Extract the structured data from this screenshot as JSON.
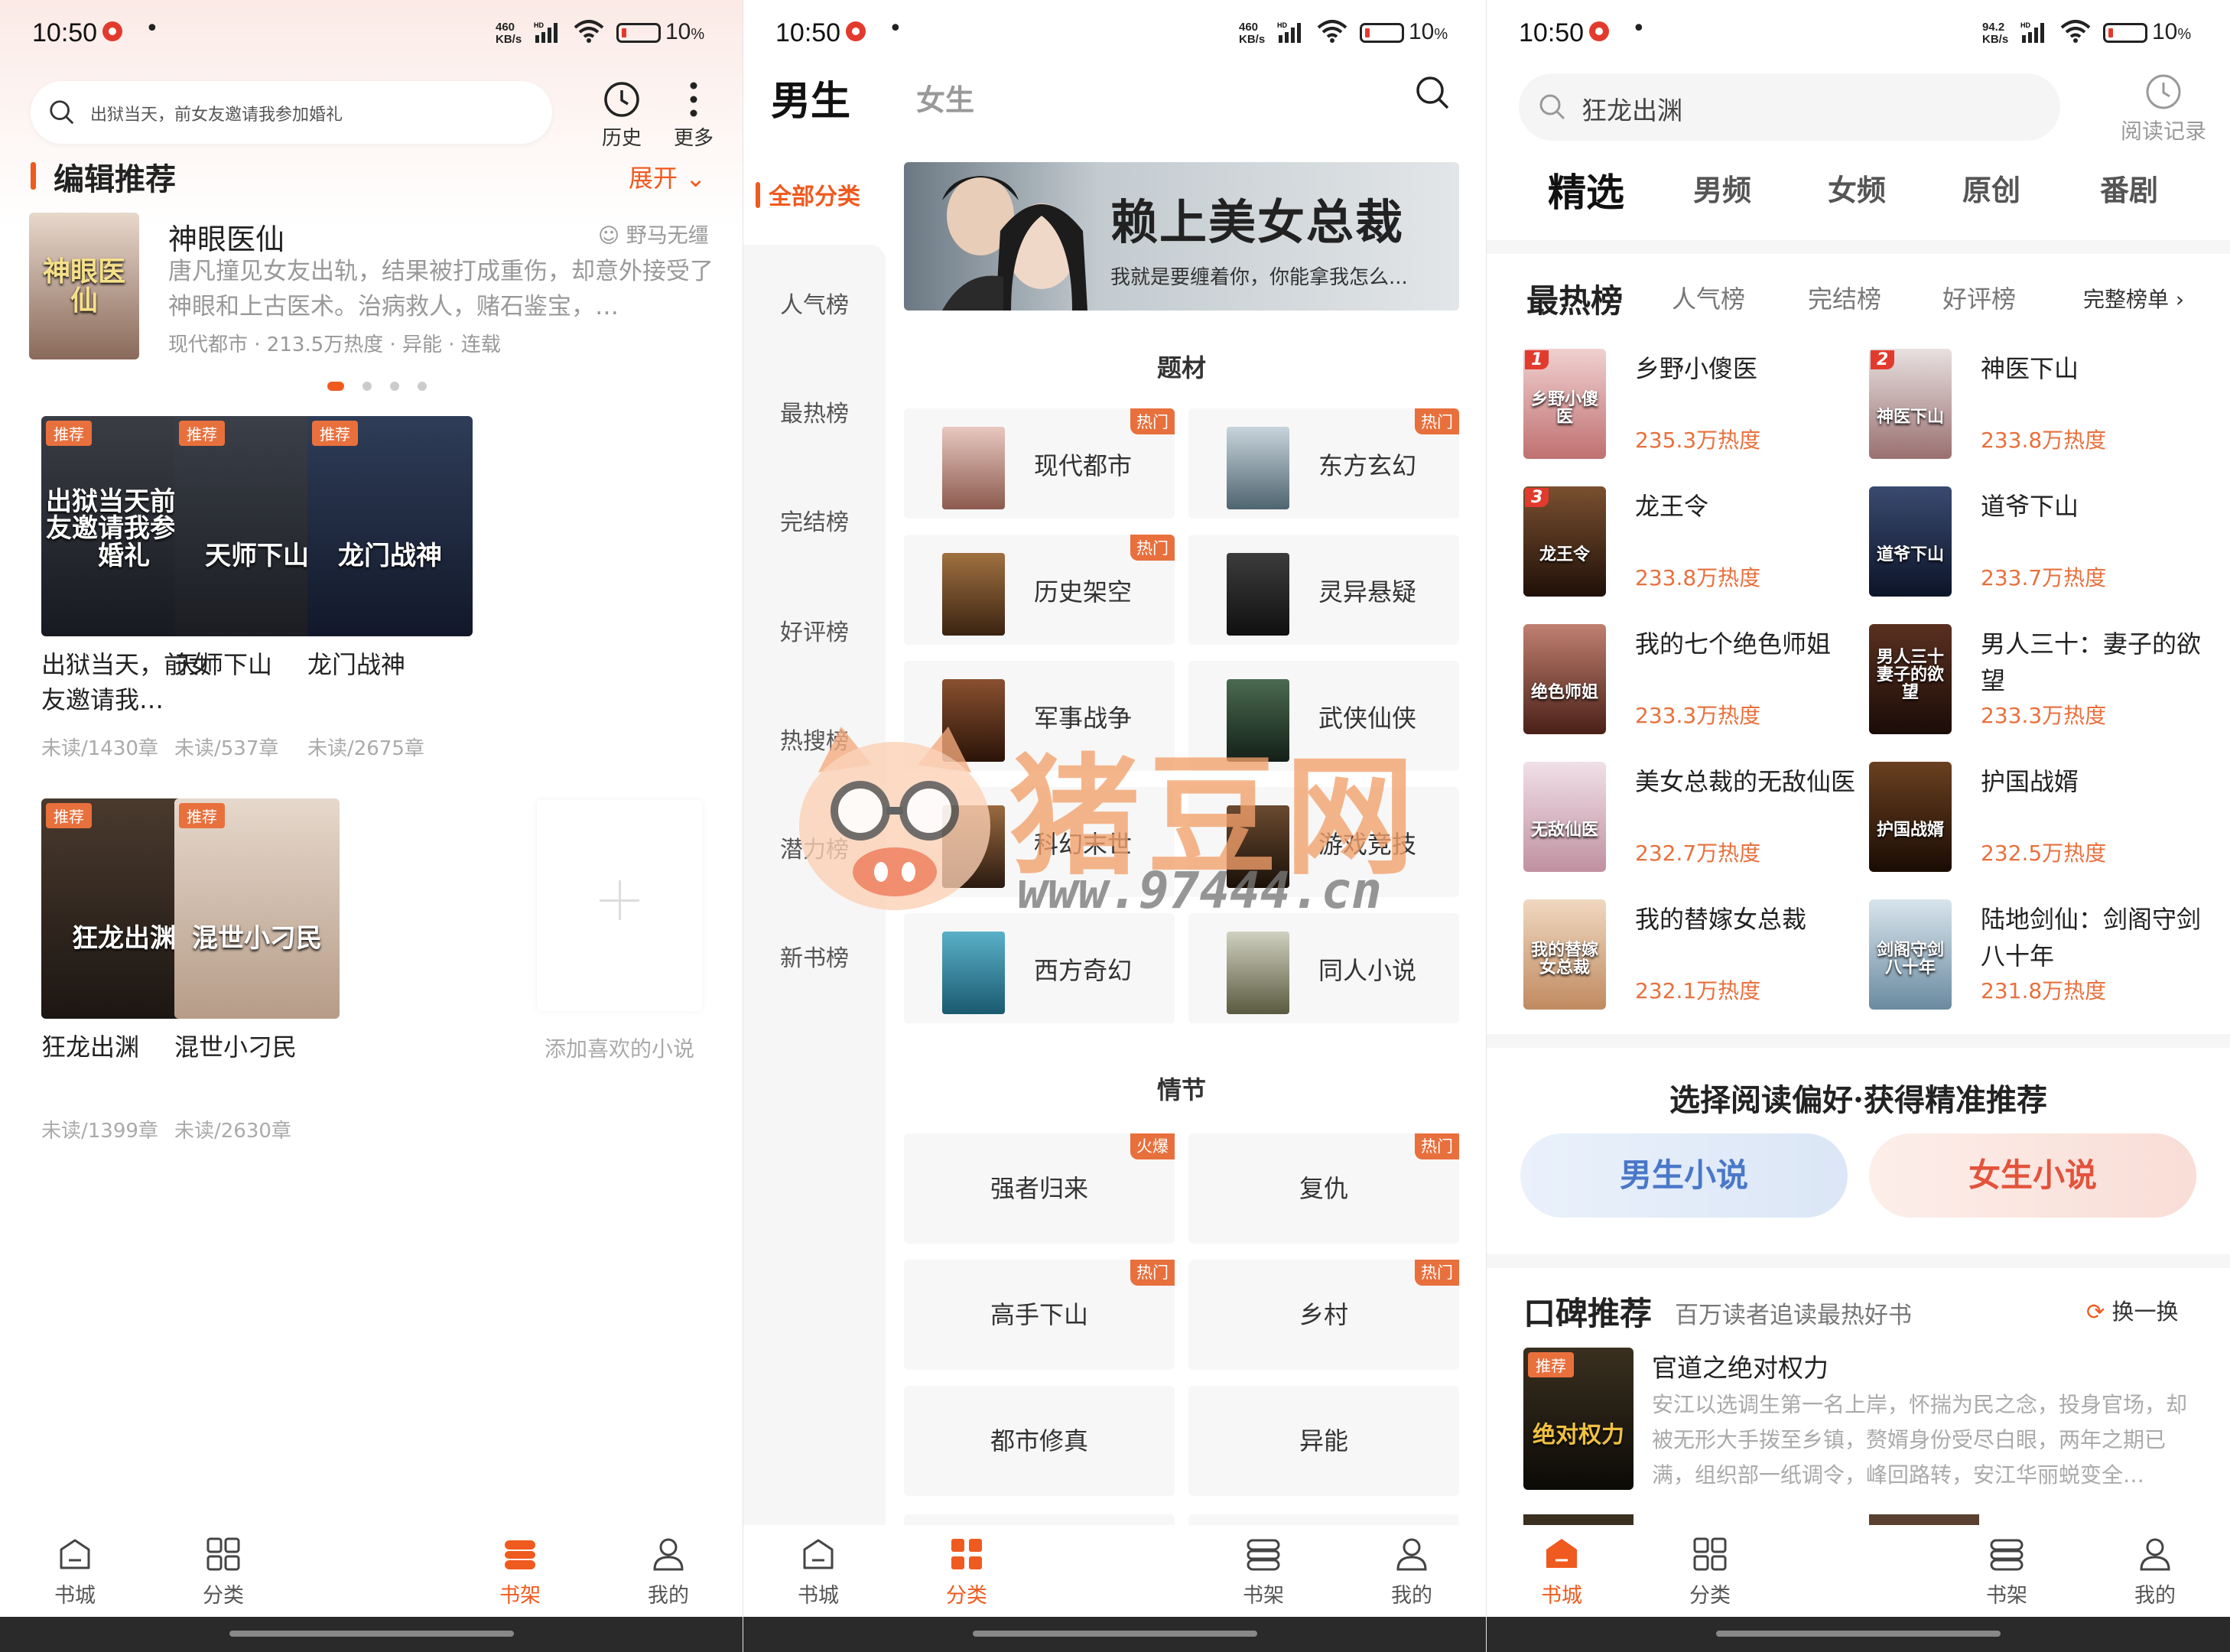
{
  "colors": {
    "accent": "#ef5a1f",
    "hot_badge": "#e8703d",
    "blue_pref": "#4a78c8",
    "red_pref": "#e3533b"
  },
  "status_bars": [
    {
      "time": "10:50",
      "speed": [
        "460",
        "KB/s"
      ],
      "hd": "HD",
      "battery": "10"
    },
    {
      "time": "10:50",
      "speed": [
        "460",
        "KB/s"
      ],
      "hd": "HD",
      "battery": "10"
    },
    {
      "time": "10:50",
      "speed": [
        "94.2",
        "KB/s"
      ],
      "hd": "HD",
      "battery": "10"
    }
  ],
  "bookshelf": {
    "search_placeholder": "出狱当天，前女友邀请我参加婚礼",
    "history_label": "历史",
    "more_label": "更多",
    "section_title": "编辑推荐",
    "expand_label": "展开",
    "featured": {
      "cover_title": "神眼医仙",
      "title": "神眼医仙",
      "author": "野马无缰",
      "desc": "唐凡撞见女友出轨，结果被打成重伤，却意外接受了神眼和上古医术。治病救人，赌石鉴宝，…",
      "meta": "现代都市 · 213.5万热度 · 异能 · 连载"
    },
    "badge": "推荐",
    "books": [
      {
        "title": "出狱当天，前女友邀请我…",
        "cover_title": "出狱当天前女友邀请我参加婚礼",
        "status": "未读/1430章",
        "c1": "#3a3d44",
        "c2": "#171a20"
      },
      {
        "title": "天师下山",
        "cover_title": "天师下山",
        "status": "未读/537章",
        "c1": "#3b3f48",
        "c2": "#1b1d22"
      },
      {
        "title": "龙门战神",
        "cover_title": "龙门战神",
        "status": "未读/2675章",
        "c1": "#2f3d58",
        "c2": "#12182a"
      },
      {
        "title": "狂龙出渊",
        "cover_title": "狂龙出渊",
        "status": "未读/1399章",
        "c1": "#4a3a2e",
        "c2": "#1c1612"
      },
      {
        "title": "混世小刁民",
        "cover_title": "混世小刁民",
        "status": "未读/2630章",
        "c1": "#e6d8cc",
        "c2": "#b69c88"
      }
    ],
    "add_label": "添加喜欢的小说"
  },
  "category": {
    "tab_male": "男生",
    "tab_female": "女生",
    "sidebar": [
      "全部分类",
      "人气榜",
      "最热榜",
      "完结榜",
      "好评榜",
      "热搜榜",
      "潜力榜",
      "新书榜"
    ],
    "banner": {
      "title": "赖上美女总裁",
      "sub": "我就是要缠着你，你能拿我怎么..."
    },
    "genre_heading": "题材",
    "genres": [
      {
        "label": "现代都市",
        "hot": "热门",
        "c1": "#e8c8c0",
        "c2": "#8c5a4e"
      },
      {
        "label": "东方玄幻",
        "hot": "热门",
        "c1": "#c8d4dc",
        "c2": "#4e6470"
      },
      {
        "label": "历史架空",
        "hot": "热门",
        "c1": "#a07040",
        "c2": "#3a2412"
      },
      {
        "label": "灵异悬疑",
        "hot": "",
        "c1": "#3c3c3c",
        "c2": "#101010"
      },
      {
        "label": "军事战争",
        "hot": "",
        "c1": "#8a5030",
        "c2": "#2a1408"
      },
      {
        "label": "武侠仙侠",
        "hot": "",
        "c1": "#4a6a50",
        "c2": "#142018"
      },
      {
        "label": "科幻末世",
        "hot": "",
        "c1": "#9a6a40",
        "c2": "#2a1a10"
      },
      {
        "label": "游戏竞技",
        "hot": "",
        "c1": "#6a4a30",
        "c2": "#1a1008"
      },
      {
        "label": "西方奇幻",
        "hot": "",
        "c1": "#5ab0c8",
        "c2": "#1a5a70"
      },
      {
        "label": "同人小说",
        "hot": "",
        "c1": "#d0d0c0",
        "c2": "#5a5a40"
      }
    ],
    "plot_heading": "情节",
    "plots": [
      {
        "label": "强者归来",
        "hot": "火爆"
      },
      {
        "label": "复仇",
        "hot": "热门"
      },
      {
        "label": "高手下山",
        "hot": "热门"
      },
      {
        "label": "乡村",
        "hot": "热门"
      },
      {
        "label": "都市修真",
        "hot": ""
      },
      {
        "label": "异能",
        "hot": ""
      }
    ]
  },
  "store": {
    "search_text": "狂龙出渊",
    "history_label": "阅读记录",
    "nav_tabs": [
      "精选",
      "男频",
      "女频",
      "原创",
      "番剧"
    ],
    "rank_tabs": [
      "最热榜",
      "人气榜",
      "完结榜",
      "好评榜"
    ],
    "full_rank": "完整榜单 ›",
    "rankings": [
      {
        "num": "1",
        "title": "乡野小傻医",
        "heat": "235.3万热度",
        "cover_title": "乡野小傻医",
        "c1": "#f0d0d0",
        "c2": "#c07070"
      },
      {
        "num": "2",
        "title": "神医下山",
        "heat": "233.8万热度",
        "cover_title": "神医下山",
        "c1": "#e8e0e0",
        "c2": "#9a7070"
      },
      {
        "num": "3",
        "title": "龙王令",
        "heat": "233.8万热度",
        "cover_title": "龙王令",
        "c1": "#7a5030",
        "c2": "#201008"
      },
      {
        "num": "",
        "title": "道爷下山",
        "heat": "233.7万热度",
        "cover_title": "道爷下山",
        "c1": "#3a4a70",
        "c2": "#0c1428"
      },
      {
        "num": "",
        "title": "我的七个绝色师姐",
        "heat": "233.3万热度",
        "cover_title": "绝色师姐",
        "c1": "#c08070",
        "c2": "#4a2018"
      },
      {
        "num": "",
        "title": "男人三十：妻子的欲望",
        "heat": "233.3万热度",
        "cover_title": "男人三十妻子的欲望",
        "c1": "#5a3020",
        "c2": "#1a0c08"
      },
      {
        "num": "",
        "title": "美女总裁的无敌仙医",
        "heat": "232.7万热度",
        "cover_title": "无敌仙医",
        "c1": "#f0e0e8",
        "c2": "#c090a0"
      },
      {
        "num": "",
        "title": "护国战婿",
        "heat": "232.5万热度",
        "cover_title": "护国战婿",
        "c1": "#6a4020",
        "c2": "#1a0c04"
      },
      {
        "num": "",
        "title": "我的替嫁女总裁",
        "heat": "232.1万热度",
        "cover_title": "我的替嫁女总裁",
        "c1": "#f0d8c0",
        "c2": "#c08a60"
      },
      {
        "num": "",
        "title": "陆地剑仙：剑阁守剑八十年",
        "heat": "231.8万热度",
        "cover_title": "剑阁守剑八十年",
        "c1": "#d8e4ec",
        "c2": "#6a8aa0"
      }
    ],
    "pref_title": "选择阅读偏好·获得精准推荐",
    "pref_male": "男生小说",
    "pref_female": "女生小说",
    "kb_title": "口碑推荐",
    "kb_sub": "百万读者追读最热好书",
    "kb_refresh": "换一换",
    "kb_book": {
      "badge": "推荐",
      "cover_title": "绝对权力",
      "title": "官道之绝对权力",
      "desc": "安江以选调生第一名上岸，怀揣为民之念，投身官场，却被无形大手拨至乡镇，赘婿身份受尽白眼，两年之期已满，组织部一纸调令，峰回路转，安江华丽蜕变全…"
    }
  },
  "tabbar": [
    "书城",
    "分类",
    "书架",
    "我的"
  ],
  "watermark": {
    "title": "猪豆网",
    "url": "www.97444.cn"
  }
}
